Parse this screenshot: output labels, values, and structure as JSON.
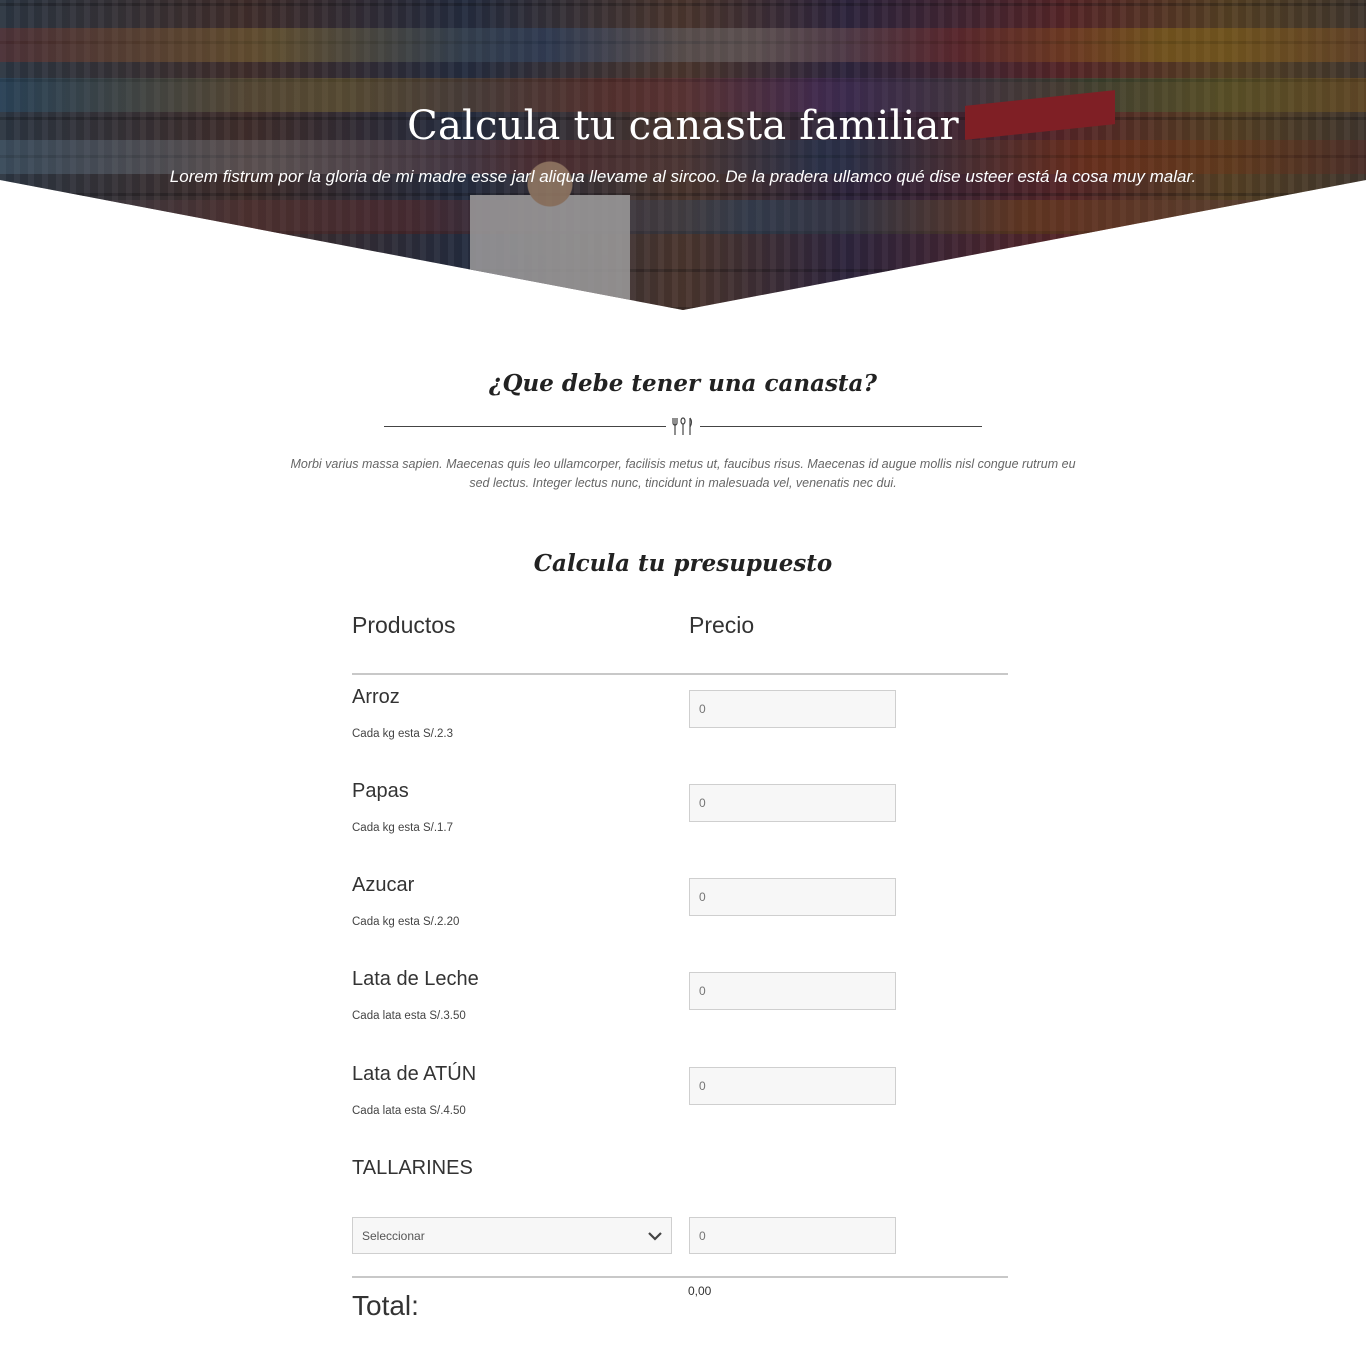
{
  "hero": {
    "title": "Calcula tu canasta familiar",
    "subtitle": "Lorem fistrum por la gloria de mi madre esse jarl aliqua llevame al sircoo. De la pradera ullamco qué dise usteer está la cosa muy malar."
  },
  "intro": {
    "title": "¿Que debe tener una canasta?",
    "divider_icon": "cutlery-icon",
    "description": "Morbi varius massa sapien. Maecenas quis leo ullamcorper, facilisis metus ut, faucibus risus. Maecenas id augue mollis nisl congue rutrum eu sed lectus. Integer lectus nunc, tincidunt in malesuada vel, venenatis nec dui."
  },
  "calculator": {
    "title": "Calcula tu presupuesto",
    "col_products": "Productos",
    "col_price": "Precio",
    "items": [
      {
        "name": "Arroz",
        "note": "Cada kg esta S/.2.3",
        "placeholder": "0"
      },
      {
        "name": "Papas",
        "note": "Cada kg esta S/.1.7",
        "placeholder": "0"
      },
      {
        "name": "Azucar",
        "note": "Cada kg esta S/.2.20",
        "placeholder": "0"
      },
      {
        "name": "Lata de Leche",
        "note": "Cada lata esta S/.3.50",
        "placeholder": "0"
      },
      {
        "name": "Lata de ATÚN",
        "note": "Cada lata esta S/.4.50",
        "placeholder": "0"
      }
    ],
    "tallarines": {
      "name": "TALLARINES",
      "select_value": "Seleccionar",
      "placeholder": "0"
    },
    "total_label": "Total:",
    "total_value": "0,00"
  },
  "colors": {
    "text": "#333333",
    "divider": "#c8c8c8",
    "input_bg": "#f7f7f7"
  }
}
